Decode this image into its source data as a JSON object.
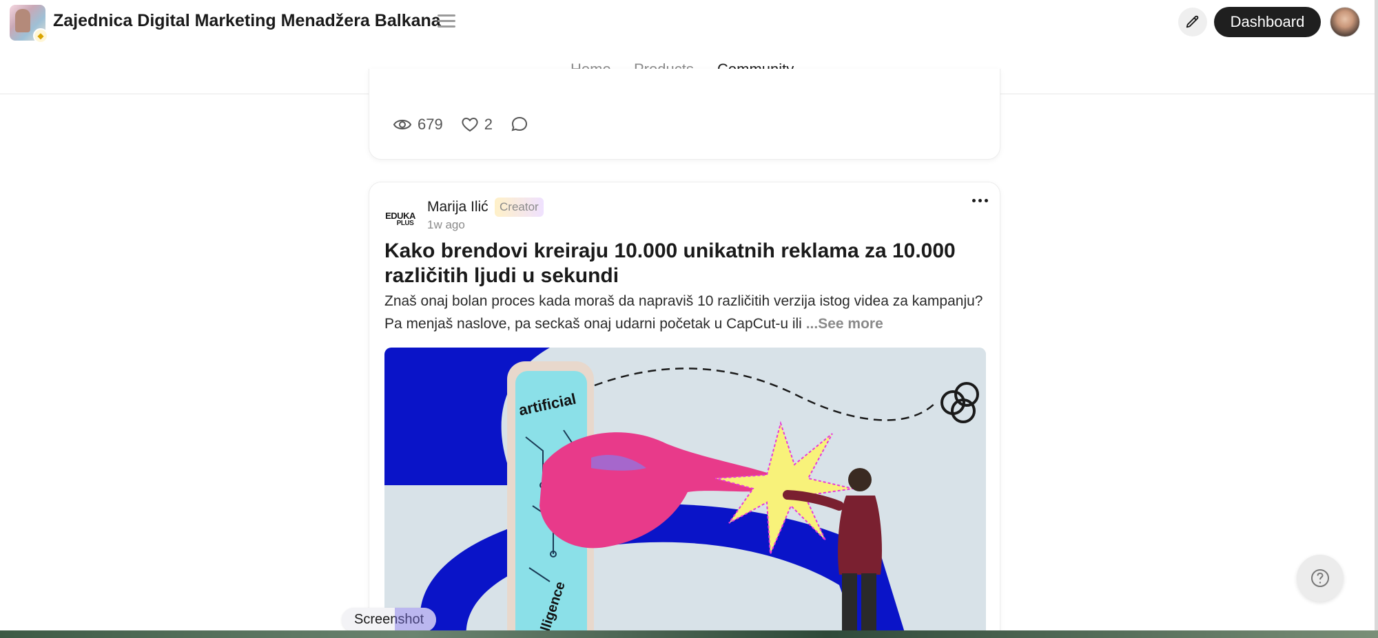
{
  "header": {
    "site_title": "Zajednica Digital Marketing Menadžera Balkana",
    "dashboard_label": "Dashboard"
  },
  "nav": {
    "tabs": [
      {
        "label": "Home",
        "active": false
      },
      {
        "label": "Products",
        "active": false
      },
      {
        "label": "Community",
        "active": true
      }
    ]
  },
  "previous_post": {
    "views": "679",
    "likes": "2"
  },
  "post": {
    "author_logo_line1": "EDUKA",
    "author_logo_line2": "PLUS",
    "author_name": "Marija Ilić",
    "author_badge": "Creator",
    "time": "1w ago",
    "title": "Kako brendovi kreiraju 10.000 unikatnih reklama za 10.000 različitih ljudi u sekundi",
    "body": "Znaš onaj bolan proces kada moraš da napraviš 10 različitih verzija istog videa za kampanju? Pa menjaš naslove, pa seckaš onaj udarni početak u CapCut-u ili ",
    "see_more": "...See more",
    "image_text_top": "artificial",
    "image_text_bottom": "intelligence"
  },
  "overlay": {
    "screenshot_label": "Screenshot"
  },
  "colors": {
    "accent_dark": "#1f1f1f",
    "creator_badge": "#fff1c8",
    "image_blue": "#0a14c8",
    "image_bg": "#d8e2e8"
  }
}
